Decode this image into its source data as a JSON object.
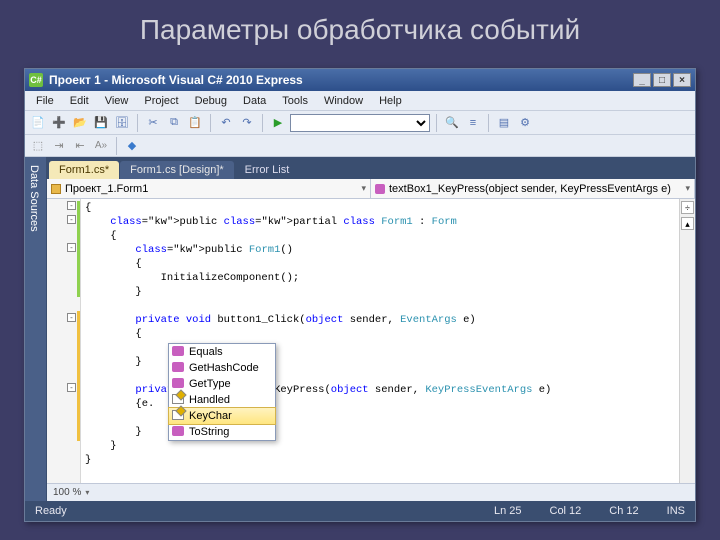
{
  "slide": {
    "title": "Параметры обработчика событий"
  },
  "window": {
    "title": "Проект 1 - Microsoft Visual C# 2010 Express",
    "min": "_",
    "max": "□",
    "close": "×"
  },
  "menu": {
    "file": "File",
    "edit": "Edit",
    "view": "View",
    "project": "Project",
    "debug": "Debug",
    "data": "Data",
    "tools": "Tools",
    "window": "Window",
    "help": "Help"
  },
  "sidebar": {
    "data_sources": "Data Sources"
  },
  "tabs": {
    "t1": "Form1.cs*",
    "t2": "Form1.cs [Design]*",
    "t3": "Error List"
  },
  "nav": {
    "left": "Проект_1.Form1",
    "right": "textBox1_KeyPress(object sender, KeyPressEventArgs e)"
  },
  "code_lines": [
    "{",
    "    public partial class Form1 : Form",
    "    {",
    "        public Form1()",
    "        {",
    "            InitializeComponent();",
    "        }",
    "",
    "        private void button1_Click(object sender, EventArgs e)",
    "        {",
    "",
    "        }",
    "",
    "        private void textBox1_KeyPress(object sender, KeyPressEventArgs e)",
    "        {e.",
    "",
    "        }",
    "    }",
    "}"
  ],
  "intellisense": {
    "items": [
      {
        "label": "Equals",
        "kind": "method"
      },
      {
        "label": "GetHashCode",
        "kind": "method"
      },
      {
        "label": "GetType",
        "kind": "method"
      },
      {
        "label": "Handled",
        "kind": "prop"
      },
      {
        "label": "KeyChar",
        "kind": "prop",
        "selected": true
      },
      {
        "label": "ToString",
        "kind": "method"
      }
    ]
  },
  "zoom": "100 %",
  "status": {
    "ready": "Ready",
    "ln": "Ln 25",
    "col": "Col 12",
    "ch": "Ch 12",
    "ins": "INS"
  }
}
